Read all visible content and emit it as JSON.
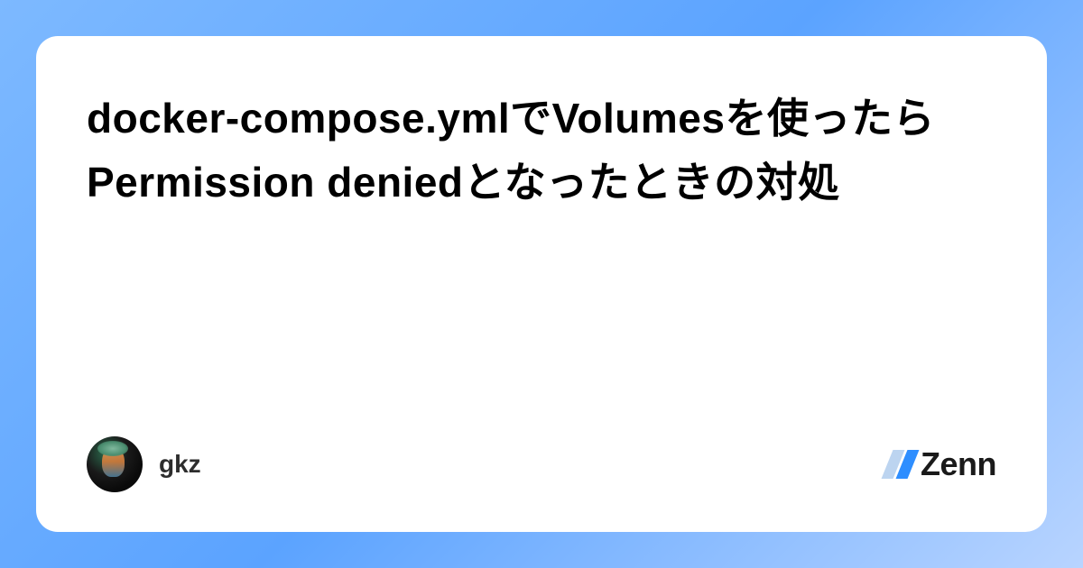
{
  "article": {
    "title": "docker-compose.ymlでVolumesを使ったらPermission deniedとなったときの対処"
  },
  "author": {
    "name": "gkz",
    "avatar_alt": "gkz avatar"
  },
  "platform": {
    "name": "Zenn"
  }
}
